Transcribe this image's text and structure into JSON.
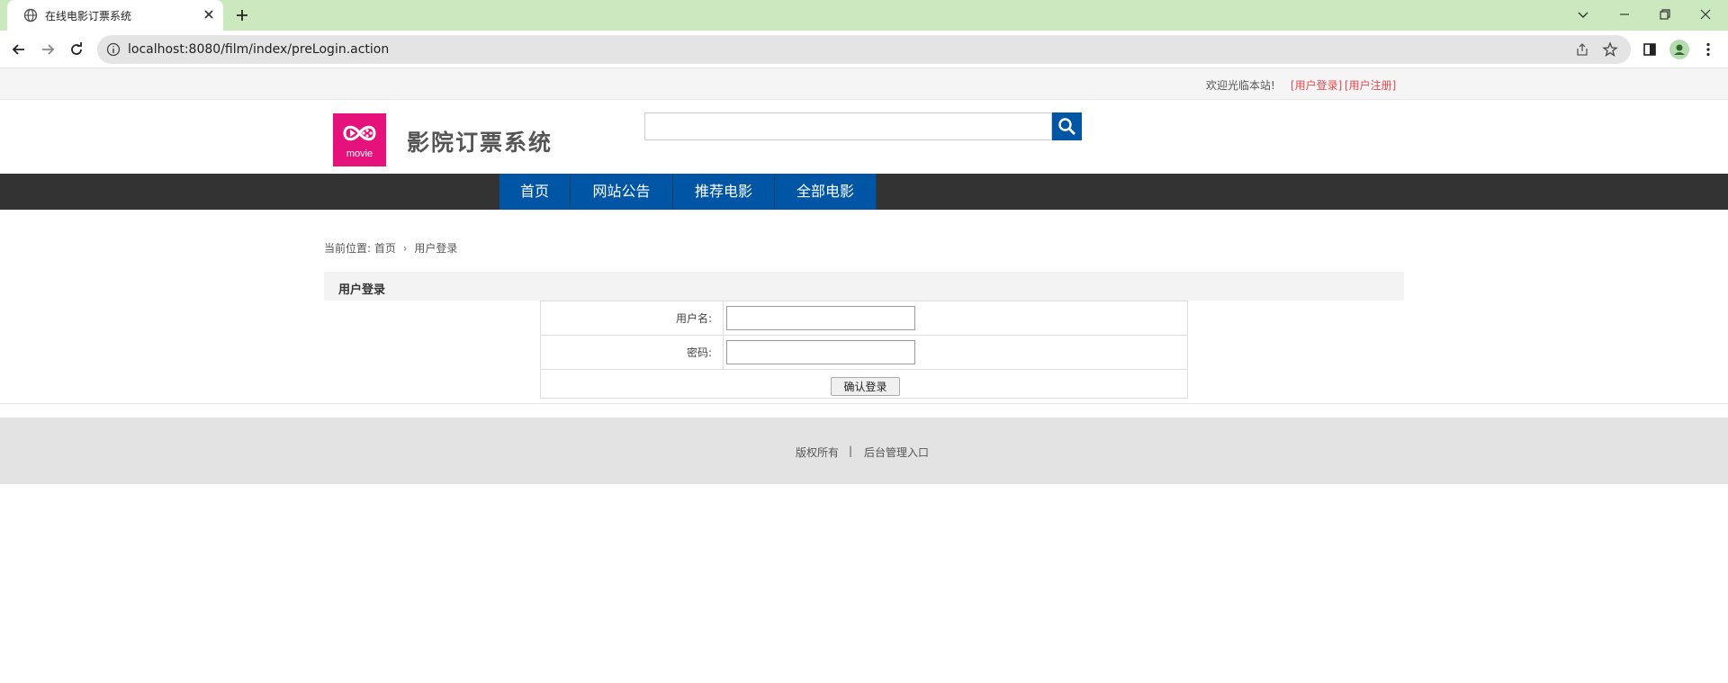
{
  "browser": {
    "tab_title": "在线电影订票系统",
    "url": "localhost:8080/film/index/preLogin.action"
  },
  "topbar": {
    "welcome": "欢迎光临本站!",
    "login_link": "[用户登录]",
    "register_link": "[用户注册]"
  },
  "header": {
    "logo_text": "movie",
    "site_name": "影院订票系统",
    "search_placeholder": ""
  },
  "nav": {
    "items": [
      {
        "label": "首页"
      },
      {
        "label": "网站公告"
      },
      {
        "label": "推荐电影"
      },
      {
        "label": "全部电影"
      }
    ]
  },
  "breadcrumb": {
    "prefix": "当前位置:",
    "home": "首页",
    "separator": "›",
    "current": "用户登录"
  },
  "login": {
    "panel_title": "用户登录",
    "username_label": "用户名:",
    "username_value": "",
    "password_label": "密码:",
    "password_value": "",
    "submit_label": "确认登录"
  },
  "footer": {
    "copyright": "版权所有",
    "separator": "|",
    "admin_link": "后台管理入口"
  },
  "colors": {
    "tab_strip": "#cce8bf",
    "brand_blue": "#0055a5",
    "nav_bg": "#333333",
    "logo_pink": "#e4127a",
    "link_red": "#e8474f"
  },
  "icons": [
    "globe-icon",
    "close-icon",
    "plus-icon",
    "chevron-down-icon",
    "minimize-icon",
    "restore-icon",
    "window-close-icon",
    "back-arrow-icon",
    "forward-arrow-icon",
    "reload-icon",
    "info-icon",
    "share-icon",
    "star-icon",
    "sidepanel-icon",
    "profile-icon",
    "more-icon",
    "search-icon"
  ]
}
